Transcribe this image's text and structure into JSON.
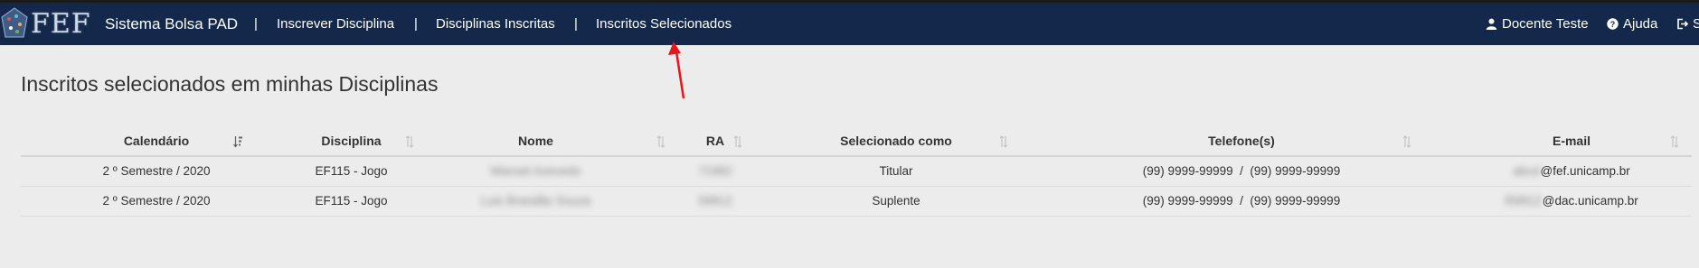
{
  "nav": {
    "logo_text": "FEF",
    "brand": "Sistema Bolsa PAD",
    "separator": "|",
    "items": [
      {
        "label": "Inscrever Disciplina"
      },
      {
        "label": "Disciplinas Inscritas"
      },
      {
        "label": "Inscritos Selecionados"
      }
    ],
    "user_label": "Docente Teste",
    "help_label": "Ajuda",
    "logout_label": "Sa"
  },
  "page": {
    "title": "Inscritos selecionados em minhas Disciplinas"
  },
  "table": {
    "columns": [
      "Calendário",
      "Disciplina",
      "Nome",
      "RA",
      "Selecionado como",
      "Telefone(s)",
      "E-mail"
    ],
    "rows": [
      {
        "calendario": "2 º Semestre / 2020",
        "disciplina": "EF115 - Jogo",
        "nome": "Manoel Azevedo",
        "ra": "71982",
        "selecionado": "Titular",
        "telefones": "(99) 9999-99999  /  (99) 9999-99999",
        "email_user": "abcd",
        "email_domain": "@fef.unicamp.br"
      },
      {
        "calendario": "2 º Semestre / 2020",
        "disciplina": "EF115 - Jogo",
        "nome": "Luis Brandão Souza",
        "ra": "59812",
        "selecionado": "Suplente",
        "telefones": "(99) 9999-99999  /  (99) 9999-99999",
        "email_user": "l59812",
        "email_domain": "@dac.unicamp.br"
      }
    ]
  },
  "colors": {
    "navbar": "#13284a",
    "background": "#ececec",
    "annotation_arrow": "#e8161b"
  }
}
